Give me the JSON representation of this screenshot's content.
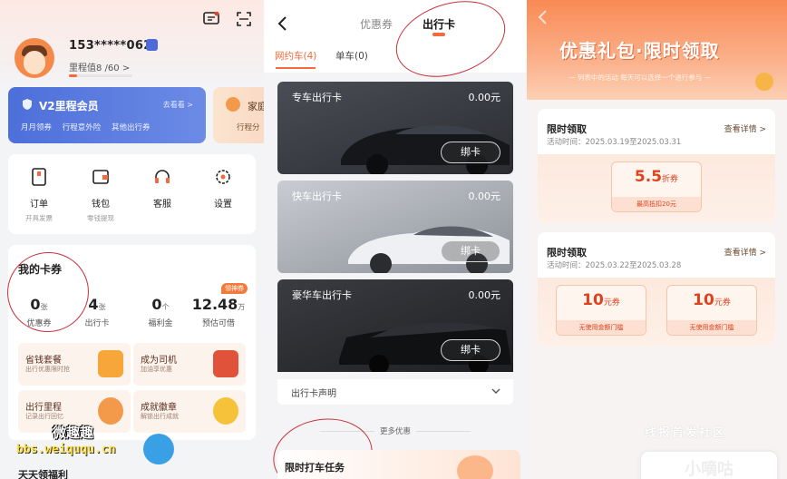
{
  "panel1": {
    "phone": "153*****062",
    "mileage": "里程值8 /60 >",
    "mileage_progress": 0.133,
    "vip": {
      "title": "V2里程会员",
      "more": "去看看 >",
      "perks": [
        "月月领券",
        "行程意外险",
        "其他出行券"
      ]
    },
    "home_card": {
      "title": "家庭",
      "perk": "行程分"
    },
    "menu": [
      {
        "label": "订单",
        "sub": "开具发票",
        "icon": "order-icon"
      },
      {
        "label": "钱包",
        "sub": "零钱提现",
        "icon": "wallet-icon"
      },
      {
        "label": "客服",
        "sub": "",
        "icon": "headset-icon"
      },
      {
        "label": "设置",
        "sub": "",
        "icon": "gear-icon"
      }
    ],
    "coupons": {
      "title": "我的卡券",
      "cash_tag": "领神券",
      "stats": [
        {
          "value": "0",
          "unit": "张",
          "label": "优惠券"
        },
        {
          "value": "4",
          "unit": "张",
          "label": "出行卡"
        },
        {
          "value": "0",
          "unit": "个",
          "label": "福利金"
        },
        {
          "value": "12.48",
          "unit": "万",
          "label": "预估可借"
        }
      ],
      "tiles": [
        {
          "title": "省钱套餐",
          "sub": "出行优惠限时抢"
        },
        {
          "title": "成为司机",
          "sub": "加油享优惠"
        },
        {
          "title": "出行里程",
          "sub": "记录出行回忆"
        },
        {
          "title": "成就徽章",
          "sub": "解锁出行成就"
        }
      ]
    },
    "watermark_line1": "微趣趣",
    "watermark_line2": "bbs.weiququ.cn",
    "section_partial": "天天领福利"
  },
  "panel2": {
    "tabs": [
      "优惠券",
      "出行卡"
    ],
    "active_tab": 1,
    "subtabs": [
      "网约车(4)",
      "单车(0)"
    ],
    "cards": [
      {
        "name": "专车出行卡",
        "amount": "0.00元",
        "bind": "绑卡"
      },
      {
        "name": "快车出行卡",
        "amount": "0.00元",
        "bind": "绑卡"
      },
      {
        "name": "豪华车出行卡",
        "amount": "0.00元",
        "bind": "绑卡"
      }
    ],
    "statement": "出行卡声明",
    "more_offers": "更多优惠",
    "task_title": "限时打车任务"
  },
  "panel3": {
    "title": "优惠礼包·限时领取",
    "subtitle": "— 列表中的活动 每天可以选择一个进行参与 —",
    "offers": [
      {
        "title": "限时领取",
        "detail": "查看详情 >",
        "time": "活动时间：2025.03.19至2025.03.31",
        "vouchers": [
          {
            "value": "5.5",
            "unit": "折券",
            "cond": "最高抵扣20元"
          }
        ]
      },
      {
        "title": "限时领取",
        "detail": "查看详情 >",
        "time": "活动时间：2025.03.22至2025.03.28",
        "vouchers": [
          {
            "value": "10",
            "unit": "元券",
            "cond": "无使用金额门槛"
          },
          {
            "value": "10",
            "unit": "元券",
            "cond": "无使用金额门槛"
          }
        ]
      }
    ],
    "watermark1": "线报首发社区",
    "watermark2": "小嘀咕"
  },
  "colors": {
    "accent": "#f36b3c",
    "vip_blue": "#4d6fd9",
    "annotation_red": "#c8323a"
  }
}
